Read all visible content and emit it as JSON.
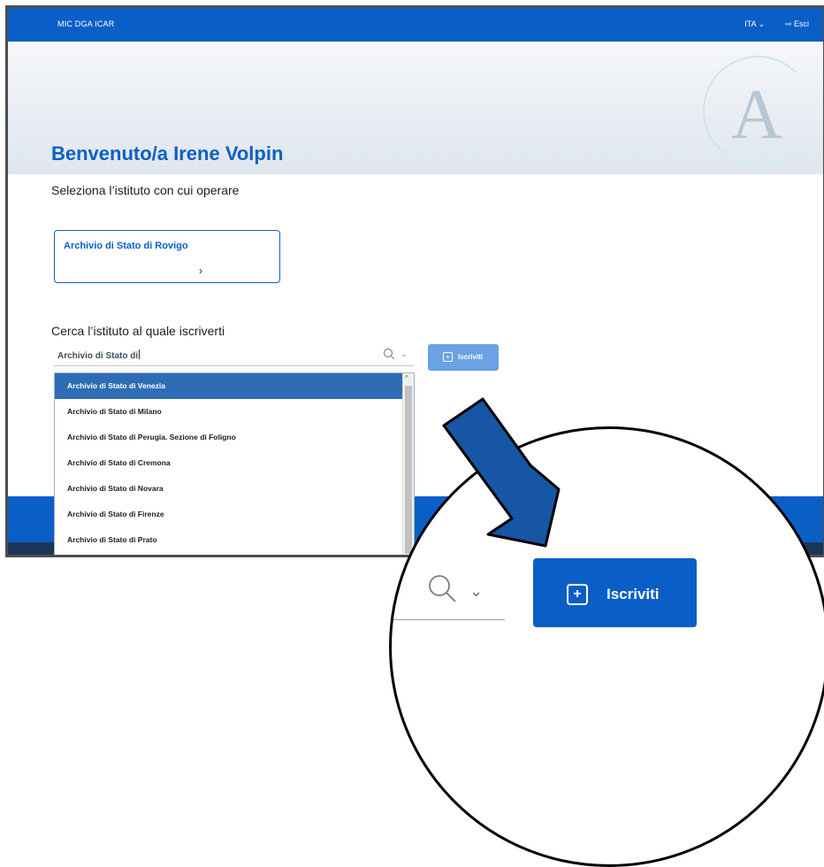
{
  "topbar": {
    "brand": "MIC  DGA  ICAR",
    "language": "ITA ⌄",
    "exit": "⇨ Esci"
  },
  "hero": {
    "logo_letter": "A",
    "welcome": "Benvenuto/a Irene Volpin"
  },
  "select_institute": {
    "label": "Seleziona l’istituto con cui operare",
    "card": {
      "name": "Archivio di Stato di Rovigo",
      "chevron": "›"
    }
  },
  "search": {
    "label": "Cerca l’istituto al quale iscriverti",
    "value": "Archivio di Stato di",
    "dropdown_icon": "⌄",
    "button_plus": "+",
    "button_label": "Iscriviti",
    "results": [
      "Archivio di Stato di Venezia",
      "Archivio di Stato di Milano",
      "Archivio di Stato di Perugia. Sezione di Foligno",
      "Archivio di Stato di Cremona",
      "Archivio di Stato di Novara",
      "Archivio di Stato di Firenze",
      "Archivio di Stato di Prato"
    ],
    "scroll_up": "^"
  },
  "zoom": {
    "dropdown_icon": "⌄",
    "button_plus": "+",
    "button_label": "Iscriviti"
  },
  "colors": {
    "primary": "#0a5fc7",
    "active_item": "#2e6db5",
    "button_light": "#6aa2e4",
    "arrow": "#1656a5"
  }
}
